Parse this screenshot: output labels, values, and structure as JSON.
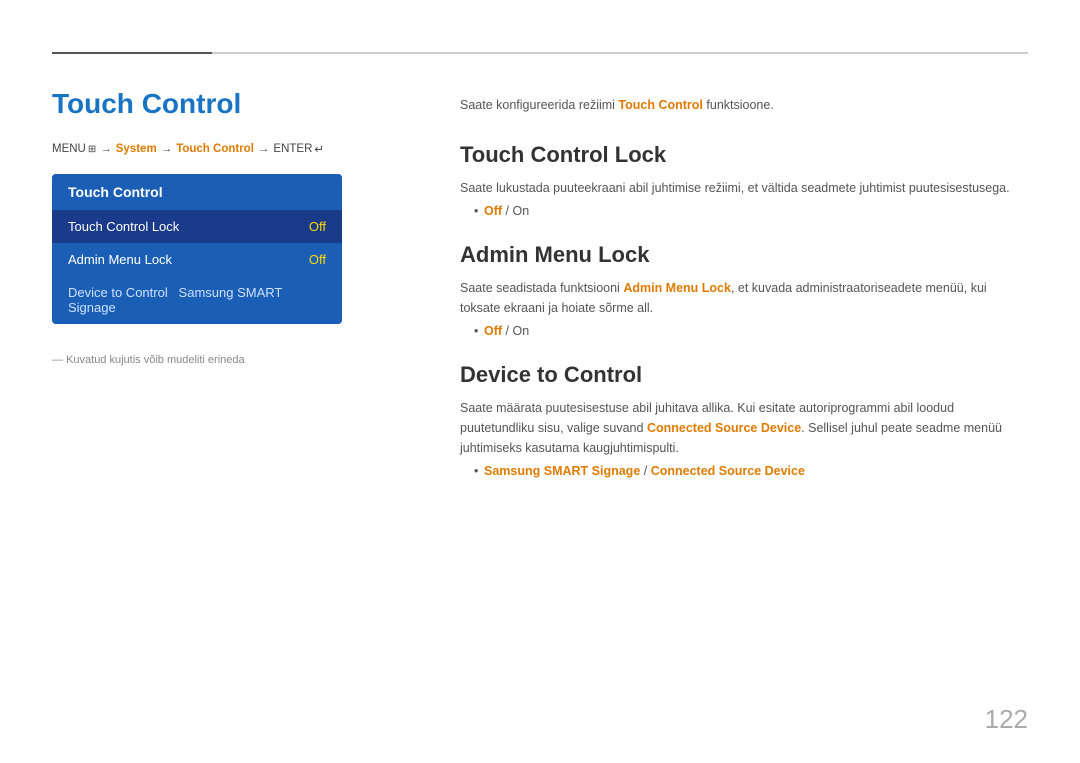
{
  "topLine": {},
  "leftColumn": {
    "pageTitle": "Touch Control",
    "menuPath": {
      "menu": "MENU",
      "menuIcon": "⊞",
      "arrow1": "→",
      "system": "System",
      "arrow2": "→",
      "touchControl": "Touch Control",
      "arrow3": "→",
      "enter": "ENTER",
      "enterIcon": "↵"
    },
    "menuBox": {
      "header": "Touch Control",
      "items": [
        {
          "label": "Touch Control Lock",
          "value": "Off",
          "active": true
        },
        {
          "label": "Admin Menu Lock",
          "value": "Off",
          "active": false
        }
      ],
      "lastItem": "Device to Control   Samsung SMART Signage"
    },
    "footnote": "Kuvatud kujutis võib mudeliti erineda"
  },
  "rightColumn": {
    "introText": "Saate konfigureerida režiimi ",
    "introTextOrange": "Touch Control",
    "introTextEnd": " funktsioone.",
    "sections": [
      {
        "id": "touch-control-lock",
        "title": "Touch Control Lock",
        "body": "Saate lukustada puuteekraani abil juhtimise režiimi, et vältida seadmete juhtimist puutesisestusega.",
        "bullet": "Off / On",
        "bulletOrangeOff": "Off",
        "bulletSlash": " / ",
        "bulletOn": "On"
      },
      {
        "id": "admin-menu-lock",
        "title": "Admin Menu Lock",
        "bodyStart": "Saate seadistada funktsiooni ",
        "bodyOrange": "Admin Menu Lock",
        "bodyEnd": ", et kuvada administraatoriseadete menüü, kui toksate ekraani ja hoiate sõrme all.",
        "bullet": "Off / On",
        "bulletOrangeOff": "Off",
        "bulletSlash": " / ",
        "bulletOn": "On"
      },
      {
        "id": "device-to-control",
        "title": "Device to Control",
        "bodyStart": "Saate määrata puutesisestuse abil juhitava allika. Kui esitate autoriprogrammi abil loodud puutetundliku sisu, valige suvand ",
        "bodyOrange": "Connected Source Device",
        "bodyEnd": ". Sellisel juhul peate seadme menüü juhtimiseks kasutama kaugjuhtimispulti.",
        "bullet1Orange1": "Samsung SMART Signage",
        "bullet1Slash": " / ",
        "bullet1Orange2": "Connected Source Device"
      }
    ]
  },
  "pageNumber": "122"
}
